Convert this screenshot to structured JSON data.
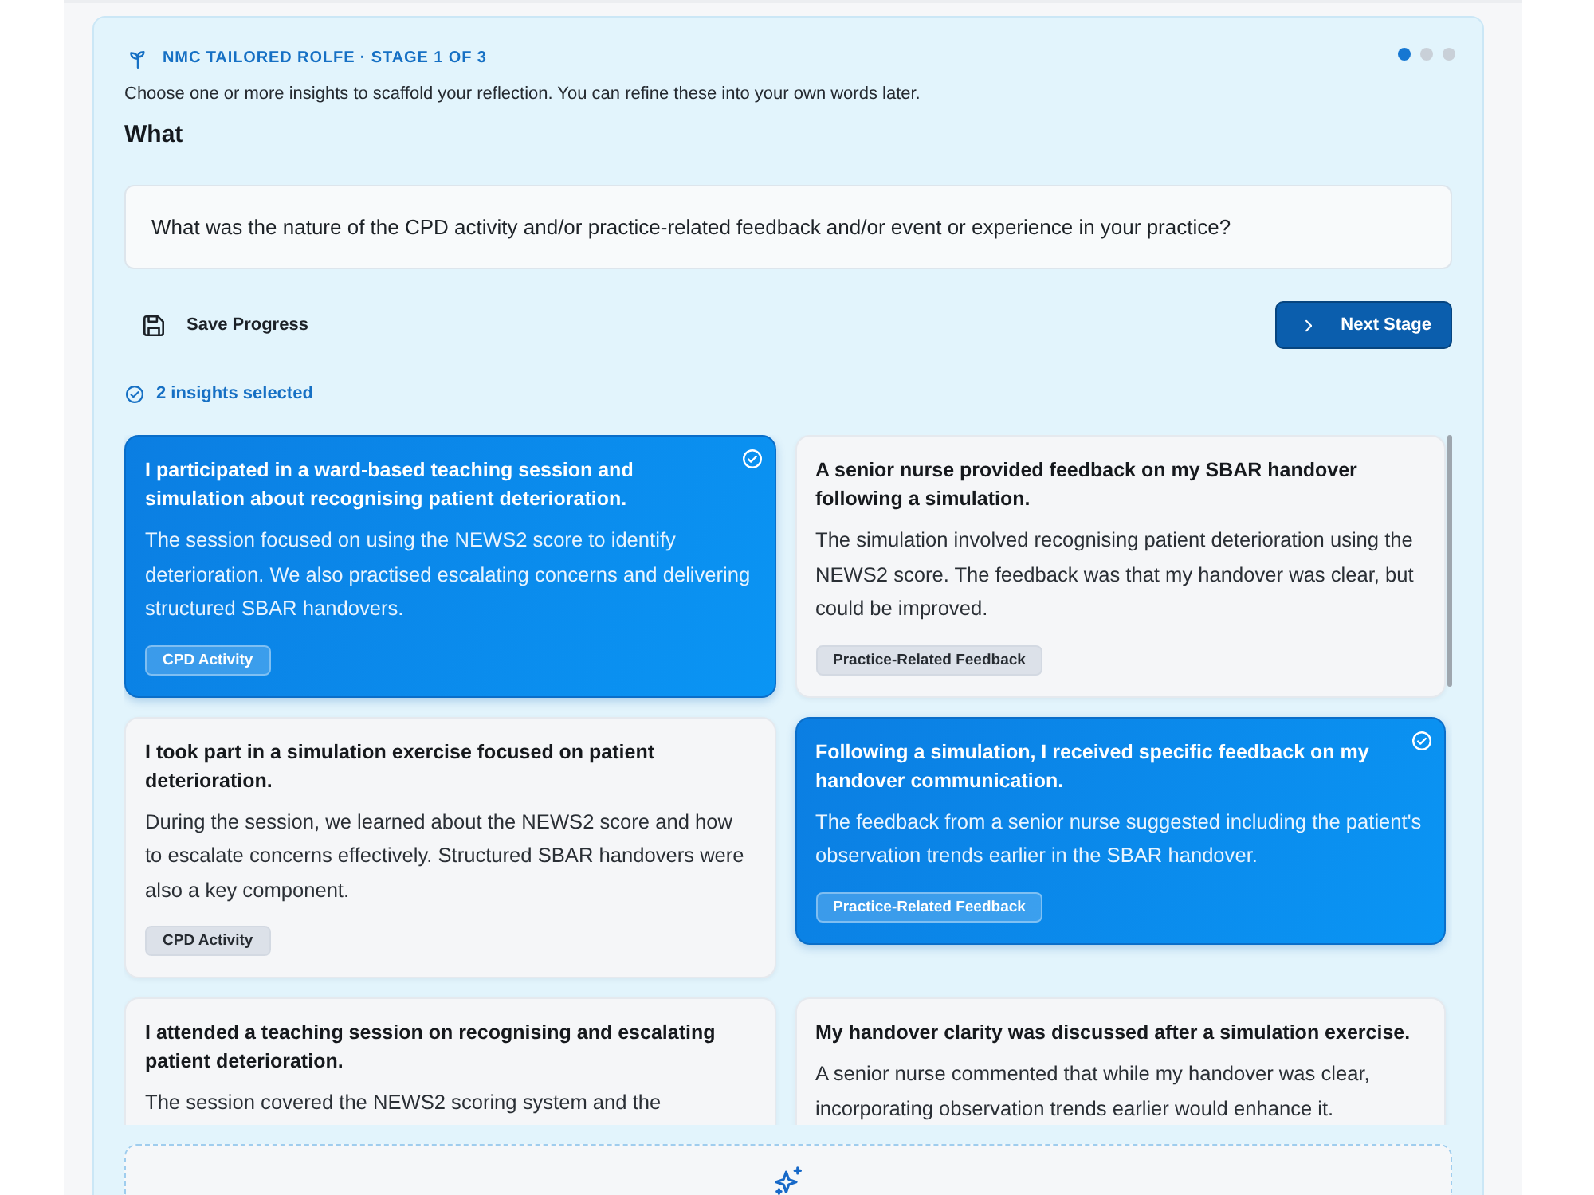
{
  "header": {
    "stage_label": "NMC TAILORED ROLFE · STAGE 1 OF 3",
    "stage_dots": [
      {
        "selected": true
      },
      {
        "selected": false
      },
      {
        "selected": false
      }
    ]
  },
  "instructions": "Choose one or more insights to scaffold your reflection. You can refine these into your own words later.",
  "section_title": "What",
  "question": "What was the nature of the CPD activity and/or practice-related feedback and/or event or experience in your practice?",
  "actions": {
    "save_button": "Save Progress",
    "next_button": "Next Stage"
  },
  "selection_summary": "2 insights selected",
  "insights": [
    {
      "title": "I participated in a ward-based teaching session and simulation about recognising patient deterioration.",
      "body": "The session focused on using the NEWS2 score to identify deterioration. We also practised escalating concerns and delivering structured SBAR handovers.",
      "tag": "CPD Activity",
      "selected": true
    },
    {
      "title": "A senior nurse provided feedback on my SBAR handover following a simulation.",
      "body": "The simulation involved recognising patient deterioration using the NEWS2 score. The feedback was that my handover was clear, but could be improved.",
      "tag": "Practice-Related Feedback",
      "selected": false
    },
    {
      "title": "I took part in a simulation exercise focused on patient deterioration.",
      "body": "During the session, we learned about the NEWS2 score and how to escalate concerns effectively. Structured SBAR handovers were also a key component.",
      "tag": "CPD Activity",
      "selected": false
    },
    {
      "title": "Following a simulation, I received specific feedback on my handover communication.",
      "body": "The feedback from a senior nurse suggested including the patient's observation trends earlier in the SBAR handover.",
      "tag": "Practice-Related Feedback",
      "selected": true
    },
    {
      "title": "I attended a teaching session on recognising and escalating patient deterioration.",
      "body": "The session covered the NEWS2 scoring system and the",
      "selected": false
    },
    {
      "title": "My handover clarity was discussed after a simulation exercise.",
      "body": "A senior nurse commented that while my handover was clear, incorporating observation trends earlier would enhance it.",
      "selected": false
    }
  ]
}
